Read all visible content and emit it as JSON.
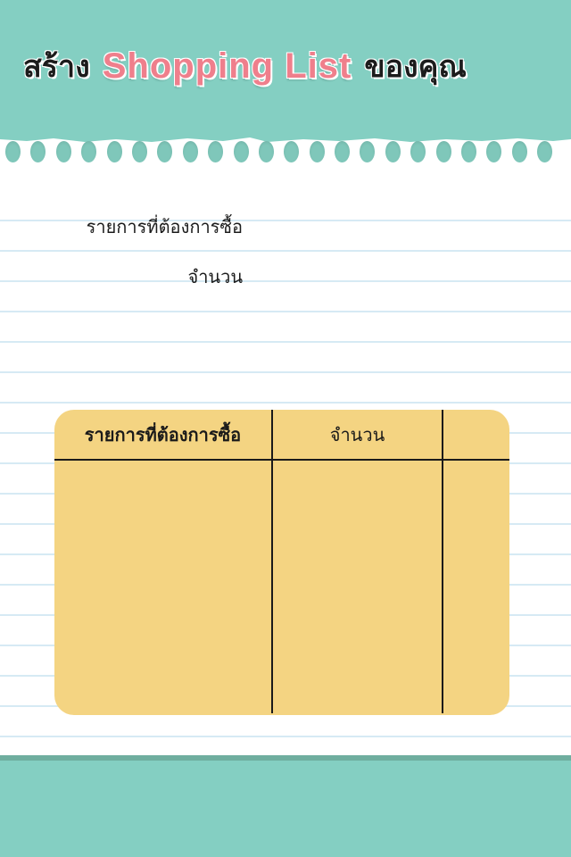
{
  "header": {
    "title_prefix": "สร้าง",
    "title_accent": "Shopping List",
    "title_suffix": "ของคุณ"
  },
  "form": {
    "item_label": "รายการที่ต้องการซื้อ",
    "quantity_label": "จำนวน"
  },
  "table": {
    "columns": [
      "รายการที่ต้องการซื้อ",
      "จำนวน",
      ""
    ]
  },
  "colors": {
    "background": "#84cfc2",
    "accent_title": "#ef7f8c",
    "table_fill": "#f4d482"
  }
}
